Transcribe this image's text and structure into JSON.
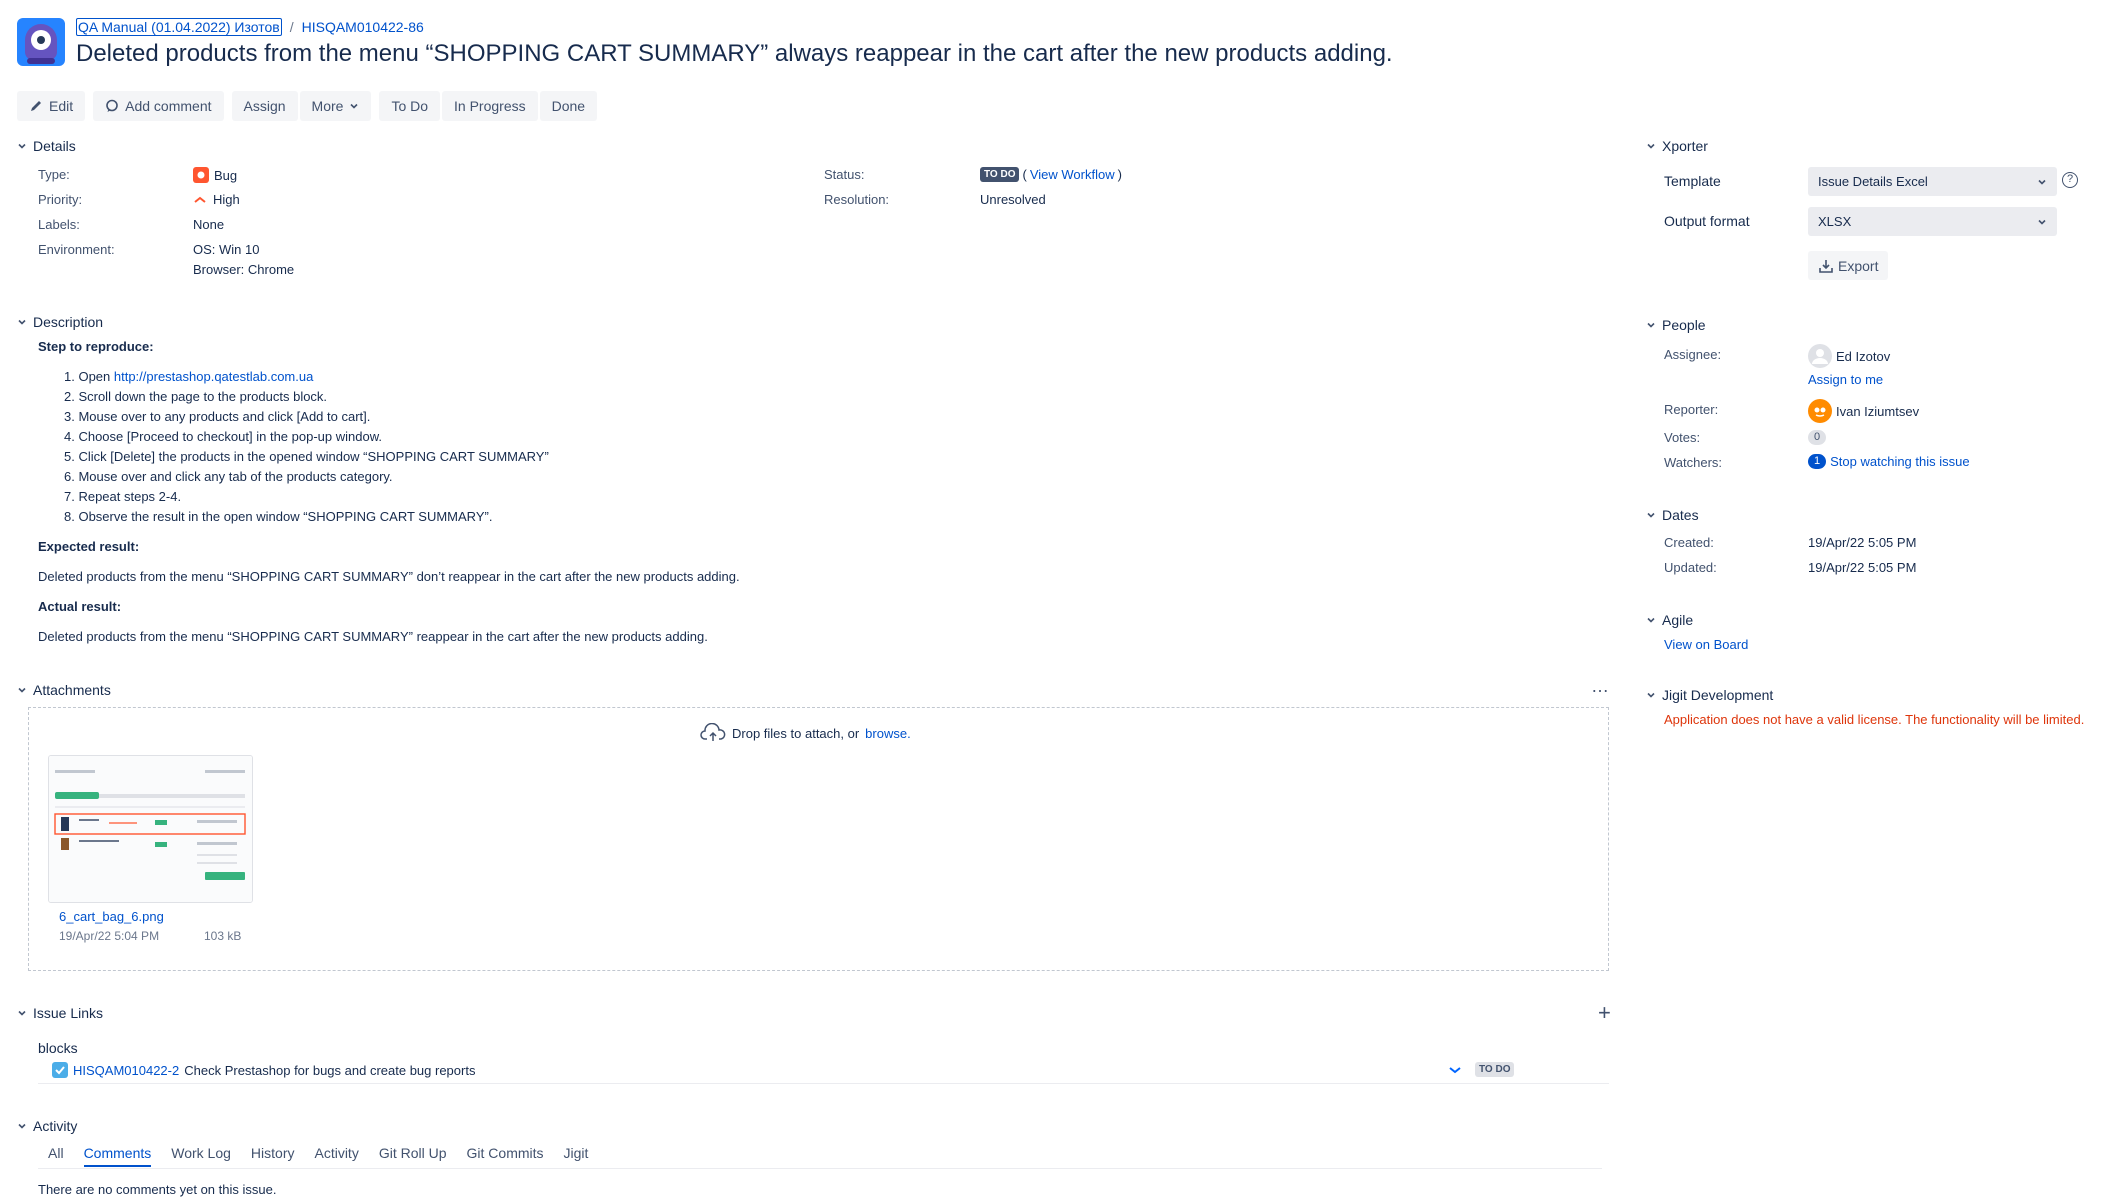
{
  "header": {
    "breadcrumb_project": "QA Manual (01.04.2022) Изотов",
    "breadcrumb_sep": "/",
    "breadcrumb_issue": "HISQAM010422-86",
    "title": "Deleted products from the menu “SHOPPING CART SUMMARY” always reappear in the cart after the new products adding."
  },
  "toolbar": {
    "edit": "Edit",
    "add_comment": "Add comment",
    "assign": "Assign",
    "more": "More",
    "todo": "To Do",
    "in_progress": "In Progress",
    "done": "Done"
  },
  "details": {
    "heading": "Details",
    "type_label": "Type:",
    "type_value": "Bug",
    "priority_label": "Priority:",
    "priority_value": "High",
    "labels_label": "Labels:",
    "labels_value": "None",
    "environment_label": "Environment:",
    "environment_line1": "OS: Win 10",
    "environment_line2": "Browser: Chrome",
    "status_label": "Status:",
    "status_value": "TO DO",
    "view_workflow_open": "(",
    "view_workflow": "View Workflow",
    "view_workflow_close": ")",
    "resolution_label": "Resolution:",
    "resolution_value": "Unresolved"
  },
  "description": {
    "heading": "Description",
    "steps_heading": "Step to reproduce:",
    "step1_prefix": "1. Open ",
    "step1_link": "http://prestashop.qatestlab.com.ua",
    "steps": [
      "2. Scroll down the page to the products block.",
      "3. Mouse over to any products and click [Add to cart].",
      "4. Choose [Proceed to checkout] in the pop-up window.",
      "5. Click [Delete] the products in the opened window “SHOPPING CART SUMMARY”",
      "6. Mouse over and click any tab of the products category.",
      "7. Repeat steps 2-4.",
      "8. Observe the result in the open window “SHOPPING CART SUMMARY”."
    ],
    "expected_heading": "Expected result:",
    "expected_text": "Deleted products from the menu “SHOPPING CART SUMMARY” don’t reappear in the cart after the new products adding.",
    "actual_heading": "Actual result:",
    "actual_text": "Deleted products from the menu “SHOPPING CART SUMMARY” reappear in the cart after the new products adding."
  },
  "attachments": {
    "heading": "Attachments",
    "more": "…",
    "drop_text": "Drop files to attach, or ",
    "browse": "browse.",
    "file_name": "6_cart_bag_6.png",
    "file_date": "19/Apr/22 5:04 PM",
    "file_size": "103 kB"
  },
  "issue_links": {
    "heading": "Issue Links",
    "add": "+",
    "relation": "blocks",
    "link_key": "HISQAM010422-2",
    "link_summary": "Check Prestashop for bugs and create bug reports",
    "link_status": "TO DO"
  },
  "activity": {
    "heading": "Activity",
    "tabs": [
      "All",
      "Comments",
      "Work Log",
      "History",
      "Activity",
      "Git Roll Up",
      "Git Commits",
      "Jigit"
    ],
    "empty": "There are no comments yet on this issue."
  },
  "xporter": {
    "heading": "Xporter",
    "template_label": "Template",
    "template_value": "Issue Details Excel",
    "output_label": "Output format",
    "output_value": "XLSX",
    "export": "Export",
    "help": "?"
  },
  "people": {
    "heading": "People",
    "assignee_label": "Assignee:",
    "assignee_value": "Ed Izotov",
    "assign_to_me": "Assign to me",
    "reporter_label": "Reporter:",
    "reporter_value": "Ivan Iziumtsev",
    "votes_label": "Votes:",
    "votes_value": "0",
    "watchers_label": "Watchers:",
    "watchers_value": "1",
    "stop_watching": "Stop watching this issue"
  },
  "dates": {
    "heading": "Dates",
    "created_label": "Created:",
    "created_value": "19/Apr/22 5:05 PM",
    "updated_label": "Updated:",
    "updated_value": "19/Apr/22 5:05 PM"
  },
  "agile": {
    "heading": "Agile",
    "view_on_board": "View on Board"
  },
  "jigit": {
    "heading": "Jigit Development",
    "error": "Application does not have a valid license. The functionality will be limited."
  },
  "colors": {
    "link": "#0052cc",
    "bug": "#ff5630",
    "priority_high": "#ff5630",
    "error": "#de350b"
  }
}
